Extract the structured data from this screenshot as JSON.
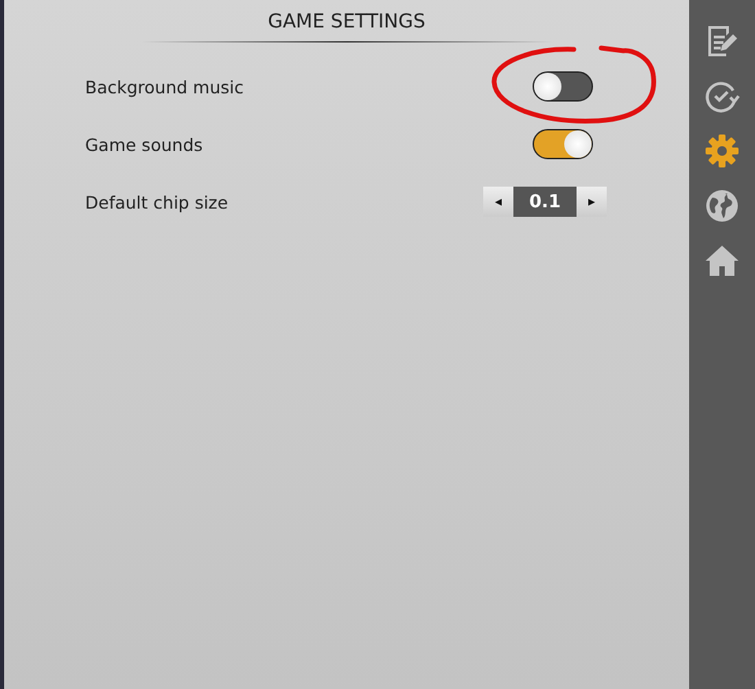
{
  "panel": {
    "title": "GAME SETTINGS"
  },
  "settings": [
    {
      "kind": "toggle",
      "label": "Background music",
      "on": false,
      "annotated": true
    },
    {
      "kind": "toggle",
      "label": "Game sounds",
      "on": true,
      "annotated": false
    },
    {
      "kind": "stepper",
      "label": "Default chip size",
      "value": "0.1",
      "decrease": "◂",
      "increase": "▸",
      "annotated": false
    }
  ],
  "sidebar": {
    "items": [
      {
        "kind": "notes",
        "selected": false
      },
      {
        "kind": "history",
        "selected": false
      },
      {
        "kind": "settings",
        "selected": true
      },
      {
        "kind": "globe",
        "selected": false
      },
      {
        "kind": "home",
        "selected": false
      }
    ]
  }
}
